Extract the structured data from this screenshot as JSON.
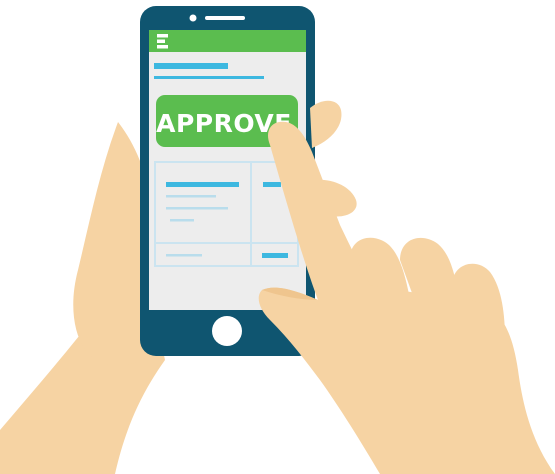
{
  "screen": {
    "approve_label": "APPROVE"
  },
  "colors": {
    "skin": "#F6D3A3",
    "skin_shadow": "#EFC58E",
    "phone_body": "#0F5570",
    "screen_bg": "#EDEDED",
    "header_bar": "#5BBD4F",
    "menu_icon": "#FFFFFF",
    "accent_line": "#3DB8E0",
    "light_line": "#B9DDEC",
    "table_border": "#CBE4F0",
    "approve_button": "#5BBD4F",
    "approve_text": "#FFFFFF",
    "home_button": "#FFFFFF",
    "speaker": "#FFFFFF"
  }
}
